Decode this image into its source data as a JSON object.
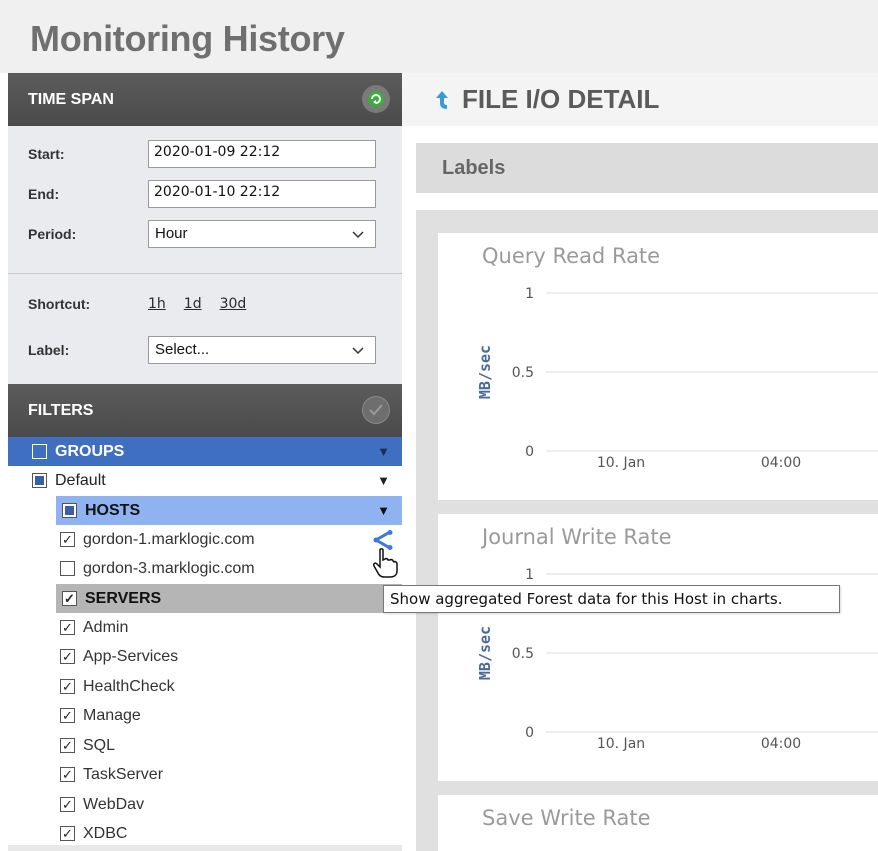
{
  "app": {
    "title": "Monitoring History"
  },
  "time_span": {
    "header": "TIME SPAN",
    "start_label": "Start:",
    "start_value": "2020-01-09 22:12",
    "end_label": "End:",
    "end_value": "2020-01-10 22:12",
    "period_label": "Period:",
    "period_value": "Hour",
    "shortcut_label": "Shortcut:",
    "shortcuts": [
      "1h",
      "1d",
      "30d"
    ],
    "label_label": "Label:",
    "label_value": "Select..."
  },
  "filters": {
    "header": "FILTERS",
    "groups_label": "GROUPS",
    "default_label": "Default",
    "hosts_label": "HOSTS",
    "hosts": [
      {
        "name": "gordon-1.marklogic.com",
        "checked": true
      },
      {
        "name": "gordon-3.marklogic.com",
        "checked": false
      }
    ],
    "servers_label": "SERVERS",
    "servers": [
      "Admin",
      "App-Services",
      "HealthCheck",
      "Manage",
      "SQL",
      "TaskServer",
      "WebDav",
      "XDBC"
    ]
  },
  "detail": {
    "title": "FILE I/O DETAIL",
    "labels_bar": "Labels"
  },
  "tooltip": "Show aggregated Forest data for this Host in charts.",
  "colors": {
    "groups_bg": "#3f6fc0",
    "hosts_bg": "#8fb3f0",
    "servers_bg": "#b5b5b5",
    "header_bg": "#4a4a4a",
    "share_icon": "#3a7ad8"
  },
  "chart_data": [
    {
      "type": "line",
      "title": "Query Read Rate",
      "ylabel": "MB/sec",
      "yticks": [
        "1",
        "0.5",
        "0"
      ],
      "xticks": [
        "10. Jan",
        "04:00"
      ],
      "ylim": [
        0,
        1
      ],
      "series": []
    },
    {
      "type": "line",
      "title": "Journal Write Rate",
      "ylabel": "MB/sec",
      "yticks": [
        "1",
        "0.5",
        "0"
      ],
      "xticks": [
        "10. Jan",
        "04:00"
      ],
      "ylim": [
        0,
        1
      ],
      "series": []
    },
    {
      "type": "line",
      "title": "Save Write Rate",
      "ylabel": "",
      "yticks": [],
      "xticks": [],
      "ylim": [
        0,
        1
      ],
      "series": []
    }
  ]
}
